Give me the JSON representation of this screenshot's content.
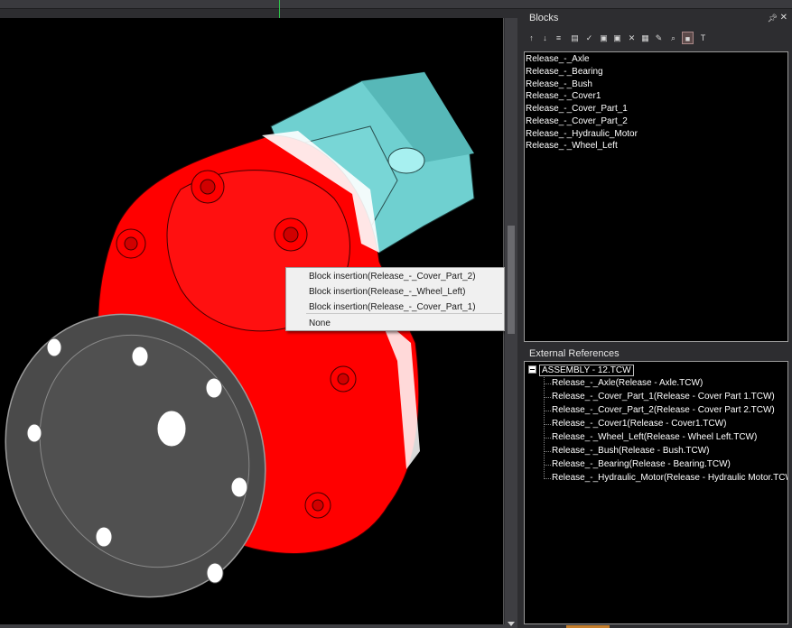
{
  "blocks_panel": {
    "title": "Blocks",
    "pin_icon": "pin-icon",
    "close_icon": "close-icon",
    "toolbar_icons": [
      "sort-icon",
      "sort-desc-icon",
      "list-icon",
      "ec-icon",
      "check-icon",
      "insert-icon",
      "insert-alt-icon",
      "delete-icon",
      "rename-icon",
      "edit-icon",
      "search-icon",
      "block-icon",
      "text-icon"
    ],
    "items": [
      "Release_-_Axle",
      "Release_-_Bearing",
      "Release_-_Bush",
      "Release_-_Cover1",
      "Release_-_Cover_Part_1",
      "Release_-_Cover_Part_2",
      "Release_-_Hydraulic_Motor",
      "Release_-_Wheel_Left"
    ]
  },
  "external_references": {
    "title": "External References",
    "root": "ASSEMBLY - 12.TCW",
    "children": [
      "Release_-_Axle(Release - Axle.TCW)",
      "Release_-_Cover_Part_1(Release - Cover Part 1.TCW)",
      "Release_-_Cover_Part_2(Release - Cover Part 2.TCW)",
      "Release_-_Cover1(Release - Cover1.TCW)",
      "Release_-_Wheel_Left(Release - Wheel Left.TCW)",
      "Release_-_Bush(Release - Bush.TCW)",
      "Release_-_Bearing(Release - Bearing.TCW)",
      "Release_-_Hydraulic_Motor(Release - Hydraulic Motor.TCW)"
    ]
  },
  "context_menu": {
    "items": [
      "Block insertion(Release_-_Cover_Part_2)",
      "Block insertion(Release_-_Wheel_Left)",
      "Block insertion(Release_-_Cover_Part_1)"
    ],
    "none_label": "None"
  },
  "colors": {
    "part_red": "#ff0000",
    "part_teal": "#6fd0d0",
    "part_gray": "#4a4a4a",
    "panel_bg": "#2d2d30"
  }
}
